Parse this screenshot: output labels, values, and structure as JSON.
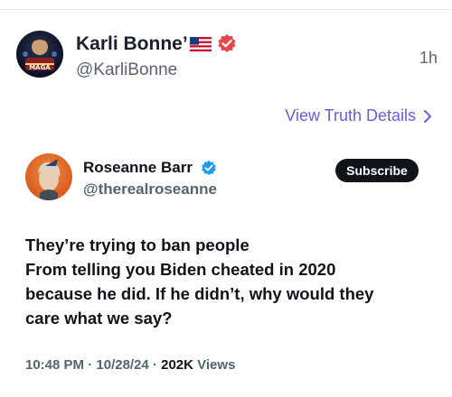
{
  "post": {
    "author_name": "Karli Bonne’",
    "author_handle": "@KarliBonne",
    "time_ago": "1h",
    "view_details_label": "View Truth Details",
    "colors": {
      "accent": "#6a5cd9",
      "verified_badge": "#e5484d"
    },
    "avatar_logo_text": "MAGA"
  },
  "embedded_post": {
    "author_name": "Roseanne Barr",
    "author_handle": "@therealroseanne",
    "subscribe_label": "Subscribe",
    "text_lines": [
      "They’re trying to ban people",
      "From telling you Biden cheated in 2020",
      "because he did. If he didn’t, why would they",
      "care what we say?"
    ],
    "meta": {
      "time": "10:48 PM",
      "date": "10/28/24",
      "views_count": "202K",
      "views_label": "Views",
      "separator": "·"
    },
    "colors": {
      "verified_badge": "#1d9bf0"
    }
  }
}
